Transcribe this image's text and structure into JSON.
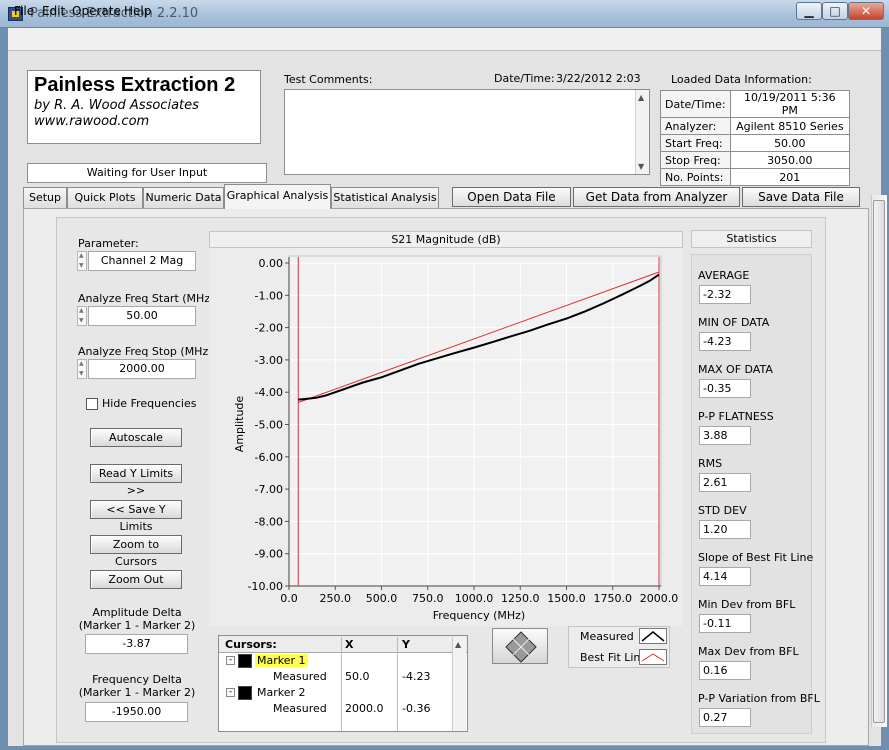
{
  "window": {
    "title": "Painless Extraction 2.2.10",
    "min_glyph": "▁",
    "max_glyph": "□",
    "close_glyph": "✕"
  },
  "menu": [
    "File",
    "Edit",
    "Operate",
    "Help"
  ],
  "header": {
    "app_name": "Painless Extraction 2",
    "author": "by R. A. Wood Associates",
    "website": "www.rawood.com",
    "status": "Waiting for User Input",
    "test_comments_label": "Test Comments:",
    "datetime_label": "Date/Time:",
    "datetime_value": "3/22/2012  2:03"
  },
  "loaded": {
    "title": "Loaded Data Information:",
    "rows": [
      {
        "key": "Date/Time:",
        "value": "10/19/2011 5:36 PM"
      },
      {
        "key": "Analyzer:",
        "value": "Agilent 8510 Series"
      },
      {
        "key": "Start Freq:",
        "value": "50.00"
      },
      {
        "key": "Stop Freq:",
        "value": "3050.00"
      },
      {
        "key": "No. Points:",
        "value": "201"
      }
    ]
  },
  "tabs": [
    "Setup",
    "Quick Plots",
    "Numeric Data",
    "Graphical Analysis",
    "Statistical Analysis"
  ],
  "active_tab": "Graphical Analysis",
  "buttons": {
    "open": "Open Data File",
    "get": "Get Data from Analyzer",
    "save": "Save Data File"
  },
  "left": {
    "parameter_label": "Parameter:",
    "parameter_value": "Channel 2 Mag",
    "start_label": "Analyze Freq Start (MHz)",
    "start_value": "50.00",
    "stop_label": "Analyze Freq Stop (MHz)",
    "stop_value": "2000.00",
    "hide_label": "Hide Frequencies",
    "autoscale": "Autoscale",
    "read_y": "Read Y Limits >>",
    "save_y": "<< Save Y Limits",
    "zoom_cursors": "Zoom to Cursors",
    "zoom_out": "Zoom Out",
    "amp_delta_label1": "Amplitude Delta",
    "amp_delta_label2": "(Marker 1 - Marker 2)",
    "amp_delta_value": "-3.87",
    "freq_delta_label1": "Frequency Delta",
    "freq_delta_label2": "(Marker 1 - Marker 2)",
    "freq_delta_value": "-1950.00"
  },
  "chart_data": {
    "type": "line",
    "title": "S21 Magnitude (dB)",
    "xlabel": "Frequency (MHz)",
    "ylabel": "Amplitude",
    "xlim": [
      0,
      2000
    ],
    "ylim": [
      -10,
      0
    ],
    "x_ticks": [
      "0.0",
      "250.0",
      "500.0",
      "750.0",
      "1000.0",
      "1250.0",
      "1500.0",
      "1750.0",
      "2000.0"
    ],
    "y_ticks": [
      "0.00",
      "-1.00",
      "-2.00",
      "-3.00",
      "-4.00",
      "-5.00",
      "-6.00",
      "-7.00",
      "-8.00",
      "-9.00",
      "-10.00"
    ],
    "grid": true,
    "legend": "bottom-right",
    "series": [
      {
        "name": "Measured",
        "color": "#000000",
        "x": [
          50,
          100,
          150,
          200,
          250,
          300,
          350,
          400,
          450,
          500,
          600,
          700,
          800,
          900,
          1000,
          1100,
          1200,
          1300,
          1400,
          1500,
          1600,
          1700,
          1800,
          1900,
          1950,
          2000
        ],
        "y": [
          -4.23,
          -4.2,
          -4.17,
          -4.1,
          -4.0,
          -3.9,
          -3.8,
          -3.7,
          -3.62,
          -3.54,
          -3.33,
          -3.12,
          -2.95,
          -2.78,
          -2.62,
          -2.45,
          -2.27,
          -2.1,
          -1.9,
          -1.72,
          -1.5,
          -1.25,
          -0.98,
          -0.7,
          -0.55,
          -0.36
        ]
      },
      {
        "name": "Best Fit Line",
        "color": "#e03030",
        "x": [
          50,
          2000
        ],
        "y": [
          -4.32,
          -0.28
        ]
      }
    ],
    "cursor_color": "#e0304a",
    "cursors_x": [
      50,
      2000
    ]
  },
  "cursors": {
    "header": [
      "Cursors:",
      "X",
      "Y"
    ],
    "marker1": "Marker 1",
    "marker2": "Marker 2",
    "measured": "Measured",
    "m1_x": "50.0",
    "m1_y": "-4.23",
    "m2_x": "2000.0",
    "m2_y": "-0.36"
  },
  "legend": {
    "measured": "Measured",
    "best_fit": "Best Fit Line"
  },
  "stats": {
    "title": "Statistics",
    "items": [
      {
        "label": "AVERAGE",
        "value": "-2.32"
      },
      {
        "label": "MIN OF DATA",
        "value": "-4.23"
      },
      {
        "label": "MAX OF DATA",
        "value": "-0.35"
      },
      {
        "label": "P-P FLATNESS",
        "value": "3.88"
      },
      {
        "label": "RMS",
        "value": "2.61"
      },
      {
        "label": "STD DEV",
        "value": "1.20"
      },
      {
        "label": "Slope of Best Fit Line",
        "value": "4.14"
      },
      {
        "label": "Min Dev from BFL",
        "value": "-0.11"
      },
      {
        "label": "Max Dev from BFL",
        "value": "0.16"
      },
      {
        "label": "P-P Variation from BFL",
        "value": "0.27"
      }
    ]
  }
}
